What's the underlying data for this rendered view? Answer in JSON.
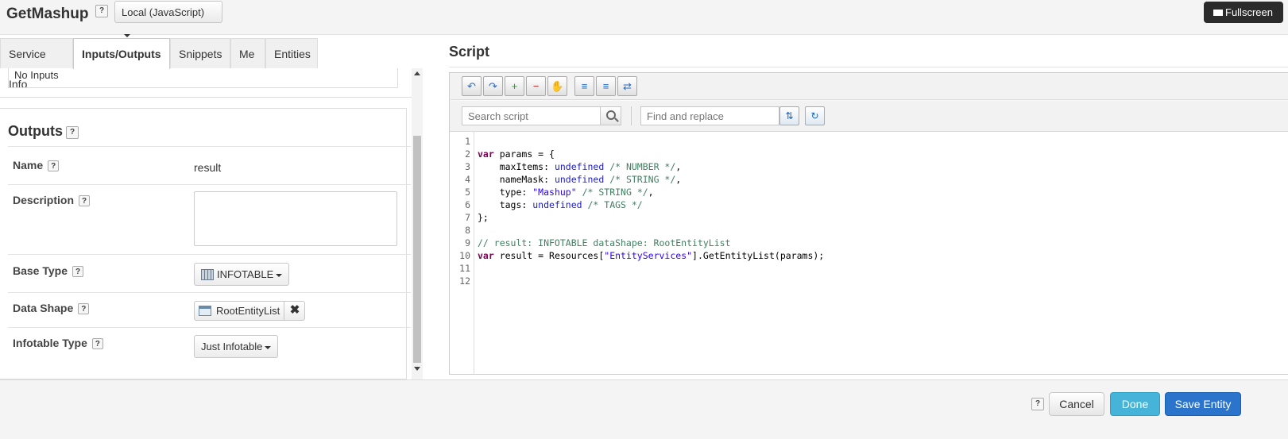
{
  "header": {
    "service_name": "GetMashup",
    "help_label": "?",
    "language_select": "Local (JavaScript)",
    "fullscreen_label": "Fullscreen"
  },
  "tabs": [
    {
      "label": "Service Info"
    },
    {
      "label": "Inputs/Outputs",
      "active": true
    },
    {
      "label": "Snippets"
    },
    {
      "label": "Me"
    },
    {
      "label": "Entities"
    }
  ],
  "inputs": {
    "empty_text": "No Inputs"
  },
  "outputs": {
    "title": "Outputs",
    "name_label": "Name",
    "name_value": "result",
    "description_label": "Description",
    "description_value": "",
    "base_type_label": "Base Type",
    "base_type_value": "INFOTABLE",
    "data_shape_label": "Data Shape",
    "data_shape_value": "RootEntityList",
    "data_shape_remove": "✖",
    "infotable_type_label": "Infotable Type",
    "infotable_type_value": "Just Infotable"
  },
  "script": {
    "title": "Script",
    "search_placeholder": "Search script",
    "find_placeholder": "Find and replace",
    "line_numbers": [
      "1",
      "2",
      "3",
      "4",
      "5",
      "6",
      "7",
      "8",
      "9",
      "10",
      "11",
      "12"
    ]
  },
  "footer": {
    "help_label": "?",
    "cancel_label": "Cancel",
    "done_label": "Done",
    "save_label": "Save Entity"
  },
  "colors": {
    "primary": "#2a74cc",
    "done": "#46b4d8",
    "keyword": "#7f0055",
    "comment": "#3f7f5f",
    "string": "#2a00ff"
  }
}
